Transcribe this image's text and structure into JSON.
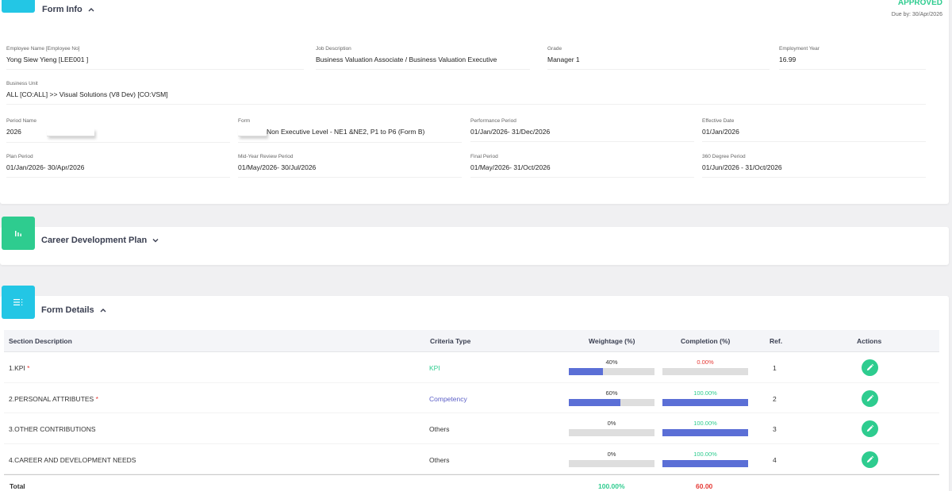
{
  "form_info": {
    "title": "Form Info",
    "status": "APPROVED",
    "due": "Due by: 30/Apr/2026",
    "fields": [
      {
        "label": "Employee Name [Employee No]",
        "value": "Yong Siew Yieng [LEE001 ]"
      },
      {
        "label": "Job Description",
        "value": "Business Valuation Associate / Business Valuation Executive"
      },
      {
        "label": "Grade",
        "value": "Manager 1"
      },
      {
        "label": "Employment Year",
        "value": "16.99"
      },
      {
        "label": "Business Unit",
        "value": "ALL [CO:ALL] >> Visual Solutions (V8 Dev) [CO:VSM]"
      },
      {
        "label": "Period Name",
        "value": "2026"
      },
      {
        "label": "Form",
        "value": "Non Executive Level - NE1 &NE2, P1 to P6 (Form B)"
      },
      {
        "label": "Performance Period",
        "value": "01/Jan/2026- 31/Dec/2026"
      },
      {
        "label": "Effective Date",
        "value": "01/Jan/2026"
      },
      {
        "label": "Plan Period",
        "value": "01/Jan/2026- 30/Apr/2026"
      },
      {
        "label": "Mid-Year Review Period",
        "value": "01/May/2026- 30/Jul/2026"
      },
      {
        "label": "Final Period",
        "value": "01/May/2026- 31/Oct/2026"
      },
      {
        "label": "360 Degree Period",
        "value": "01/Jun/2026 - 31/Oct/2026"
      }
    ]
  },
  "career": {
    "title": "Career Development Plan"
  },
  "details": {
    "title": "Form Details",
    "headers": {
      "section": "Section Description",
      "criteria": "Criteria Type",
      "weightage": "Weightage (%)",
      "completion": "Completion (%)",
      "ref": "Ref.",
      "actions": "Actions"
    },
    "rows": [
      {
        "section": "1.KPI",
        "required": "*",
        "criteria": "KPI",
        "weightage": "40%",
        "weightage_value": 40,
        "completion": "0.00%",
        "completion_value": 0,
        "ref": "1"
      },
      {
        "section": "2.PERSONAL ATTRIBUTES",
        "required": "*",
        "criteria": "Competency",
        "weightage": "60%",
        "weightage_value": 60,
        "completion": "100.00%",
        "completion_value": 100,
        "ref": "2"
      },
      {
        "section": "3.OTHER CONTRIBUTIONS",
        "required": "",
        "criteria": "Others",
        "weightage": "0%",
        "weightage_value": 0,
        "completion": "100.00%",
        "completion_value": 100,
        "ref": "3"
      },
      {
        "section": "4.CAREER AND DEVELOPMENT NEEDS",
        "required": "",
        "criteria": "Others",
        "weightage": "0%",
        "weightage_value": 0,
        "completion": "100.00%",
        "completion_value": 100,
        "ref": "4"
      }
    ],
    "total": {
      "label": "Total",
      "weightage": "100.00%",
      "completion": "60.00"
    }
  },
  "colors": {
    "accent_green": "#2ecc8f",
    "accent_cyan": "#23c6e5",
    "bar_fill": "#5b6fd6",
    "danger": "#e53935"
  }
}
